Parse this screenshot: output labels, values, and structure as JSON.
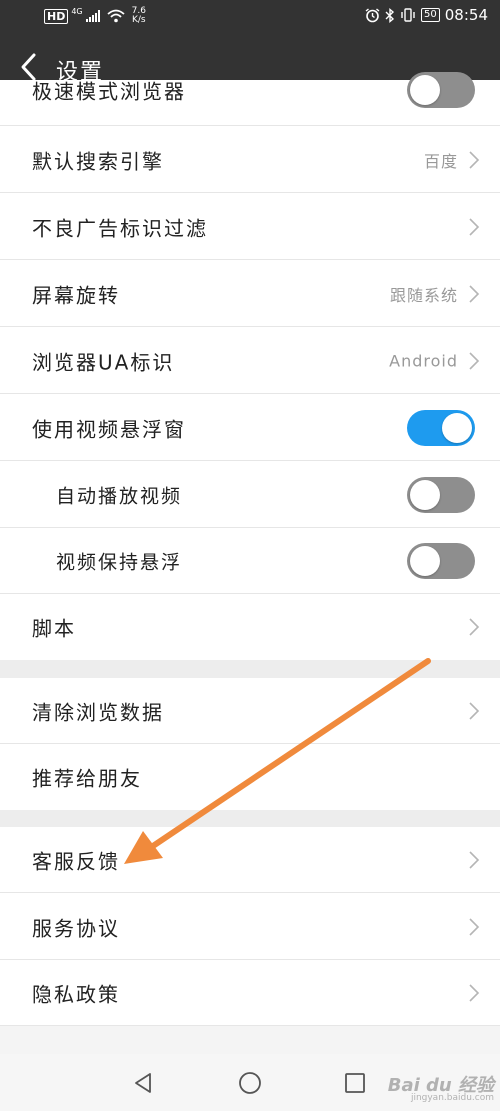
{
  "status_bar": {
    "hd": "HD",
    "network": "4G",
    "speed_value": "7.6",
    "speed_unit": "K/s",
    "battery": "50",
    "time": "08:54"
  },
  "header": {
    "back_icon": "chevron-left-icon",
    "title": "设置"
  },
  "settings": {
    "partial_item": {
      "label": "极速模式浏览器",
      "toggle_on": false
    },
    "search_engine": {
      "label": "默认搜索引擎",
      "value": "百度"
    },
    "ad_filter": {
      "label": "不良广告标识过滤"
    },
    "screen_rotation": {
      "label": "屏幕旋转",
      "value": "跟随系统"
    },
    "ua": {
      "label": "浏览器UA标识",
      "value": "Android"
    },
    "video_float": {
      "label": "使用视频悬浮窗",
      "toggle_on": true
    },
    "autoplay": {
      "label": "自动播放视频",
      "toggle_on": false
    },
    "keep_float": {
      "label": "视频保持悬浮",
      "toggle_on": false
    },
    "script": {
      "label": "脚本"
    },
    "clear_data": {
      "label": "清除浏览数据"
    },
    "recommend": {
      "label": "推荐给朋友"
    },
    "feedback": {
      "label": "客服反馈"
    },
    "agreement": {
      "label": "服务协议"
    },
    "privacy": {
      "label": "隐私政策"
    }
  },
  "nav_bar": {
    "back": "triangle-back-icon",
    "home": "circle-home-icon",
    "recents": "square-recents-icon"
  },
  "colors": {
    "header_bg": "#333333",
    "toggle_on": "#1e9bef",
    "toggle_off": "#8e8e8e",
    "arrow": "#f08a3c",
    "section_gap": "#ededed"
  },
  "watermark": {
    "brand": "Bai du 经验",
    "url": "jingyan.baidu.com"
  }
}
